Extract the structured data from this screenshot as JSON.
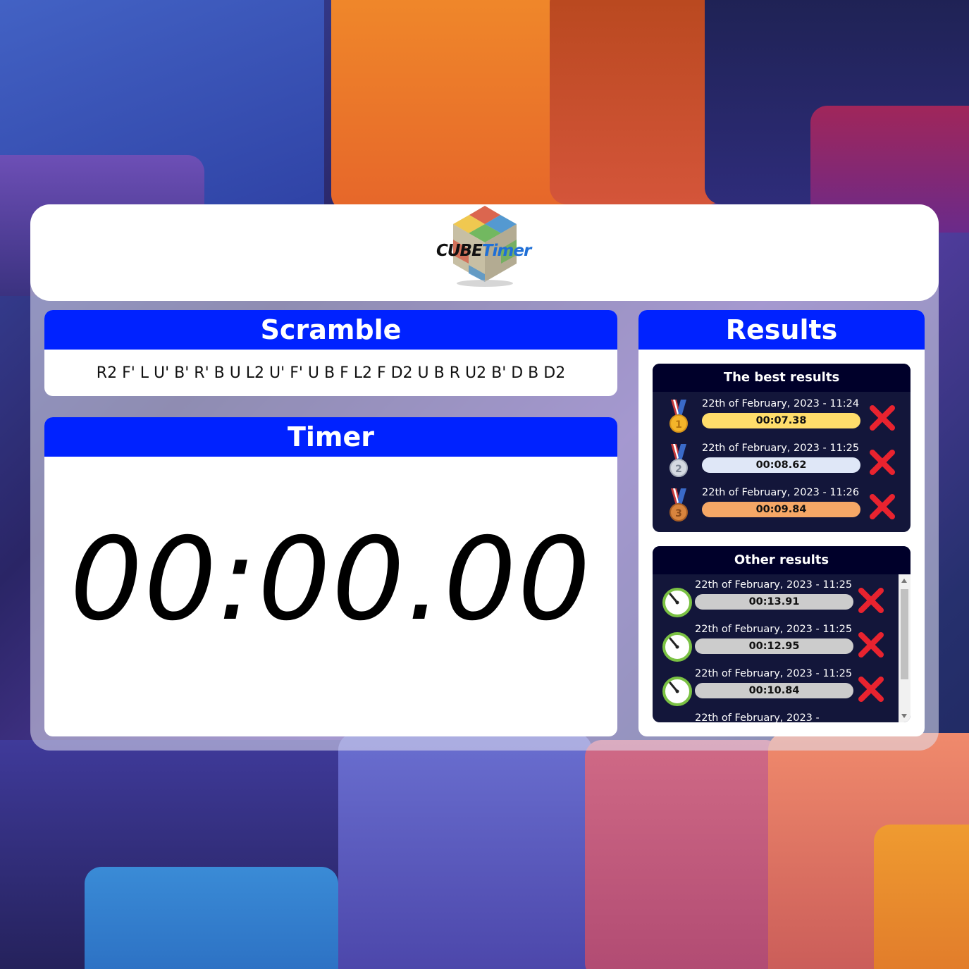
{
  "app": {
    "logo_text_part1": "CUBE",
    "logo_text_part2": "Timer"
  },
  "scramble": {
    "title": "Scramble",
    "sequence": "R2 F' L U' B' R' B U L2 U' F' U B F L2 F D2 U B R U2 B' D B D2"
  },
  "timer": {
    "title": "Timer",
    "value": "00:00.00"
  },
  "results": {
    "title": "Results",
    "best": {
      "title": "The best results",
      "items": [
        {
          "date": "22th of February, 2023 - 11:24",
          "time": "00:07.38",
          "medal": "gold-medal-icon",
          "color": "#ffdd6b"
        },
        {
          "date": "22th of February, 2023 - 11:25",
          "time": "00:08.62",
          "medal": "silver-medal-icon",
          "color": "#dfe7f7"
        },
        {
          "date": "22th of February, 2023 - 11:26",
          "time": "00:09.84",
          "medal": "bronze-medal-icon",
          "color": "#f5a766"
        }
      ]
    },
    "other": {
      "title": "Other results",
      "items": [
        {
          "date": "22th of February, 2023 - 11:25",
          "time": "00:13.91"
        },
        {
          "date": "22th of February, 2023 - 11:25",
          "time": "00:12.95"
        },
        {
          "date": "22th of February, 2023 - 11:25",
          "time": "00:10.84"
        },
        {
          "date": "22th of February, 2023 -",
          "time": ""
        }
      ]
    }
  },
  "icons": {
    "delete": "close-icon",
    "stopwatch": "stopwatch-icon"
  },
  "colors": {
    "accent": "#0022ff",
    "panel_dark": "#13163a",
    "delete_red": "#e8232f",
    "stopwatch_green": "#7ac143"
  }
}
